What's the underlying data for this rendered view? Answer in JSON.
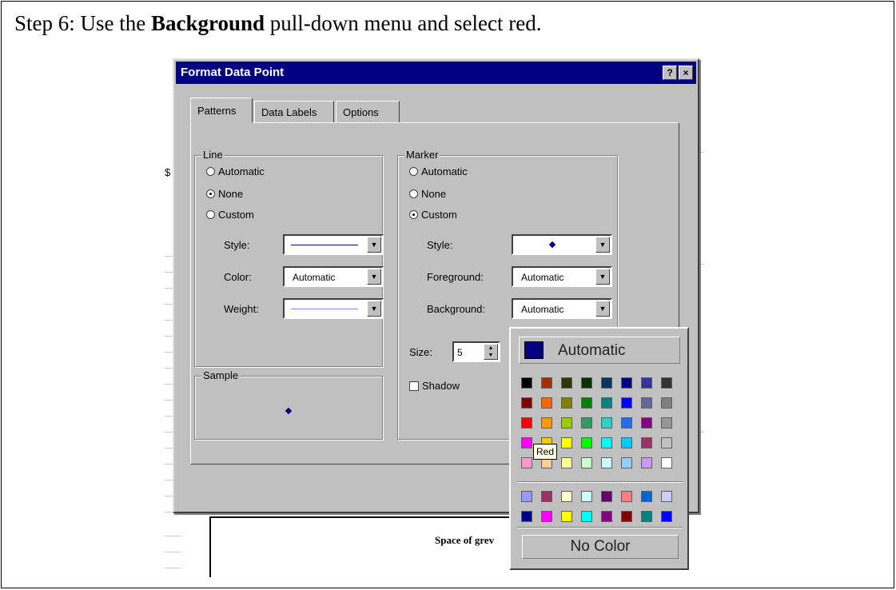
{
  "caption": {
    "prefix": "Step 6: Use the ",
    "bold": "Background",
    "suffix": " pull-down menu and select red."
  },
  "sheet": {
    "chart_title": "Space of grev",
    "stub": "$"
  },
  "dialog": {
    "title": "Format Data Point",
    "help_btn": "?",
    "close_btn": "×",
    "tabs": [
      "Patterns",
      "Data Labels",
      "Options"
    ],
    "line": {
      "label": "Line",
      "automatic": "Automatic",
      "none": "None",
      "custom": "Custom",
      "selected": "none",
      "style_label": "Style:",
      "color_label": "Color:",
      "color_value": "Automatic",
      "weight_label": "Weight:"
    },
    "marker": {
      "label": "Marker",
      "automatic": "Automatic",
      "none": "None",
      "custom": "Custom",
      "selected": "custom",
      "style_label": "Style:",
      "foreground_label": "Foreground:",
      "foreground_value": "Automatic",
      "background_label": "Background:",
      "background_value": "Automatic",
      "size_label": "Size:",
      "size_value": "5",
      "shadow_label": "Shadow"
    },
    "sample_label": "Sample"
  },
  "palette": {
    "automatic_label": "Automatic",
    "no_color_label": "No Color",
    "tooltip": "Red",
    "colors": [
      [
        "#000000",
        "#993300",
        "#333300",
        "#003300",
        "#003366",
        "#000080",
        "#333399",
        "#333333"
      ],
      [
        "#800000",
        "#FF6600",
        "#808000",
        "#008000",
        "#008080",
        "#0000FF",
        "#666699",
        "#808080"
      ],
      [
        "#FF0000",
        "#FF9900",
        "#99CC00",
        "#339966",
        "#33CCCC",
        "#3366FF",
        "#800080",
        "#969696"
      ],
      [
        "#FF00FF",
        "#FFCC00",
        "#FFFF00",
        "#00FF00",
        "#00FFFF",
        "#00CCFF",
        "#993366",
        "#C0C0C0"
      ],
      [
        "#FF99CC",
        "#FFCC99",
        "#FFFF99",
        "#CCFFCC",
        "#CCFFFF",
        "#99CCFF",
        "#CC99FF",
        "#FFFFFF"
      ]
    ],
    "chart_colors": [
      [
        "#9999FF",
        "#993366",
        "#FFFFCC",
        "#CCFFFF",
        "#660066",
        "#FF8080",
        "#0066CC",
        "#CCCCFF"
      ],
      [
        "#000080",
        "#FF00FF",
        "#FFFF00",
        "#00FFFF",
        "#800080",
        "#800000",
        "#008080",
        "#0000FF"
      ]
    ]
  }
}
